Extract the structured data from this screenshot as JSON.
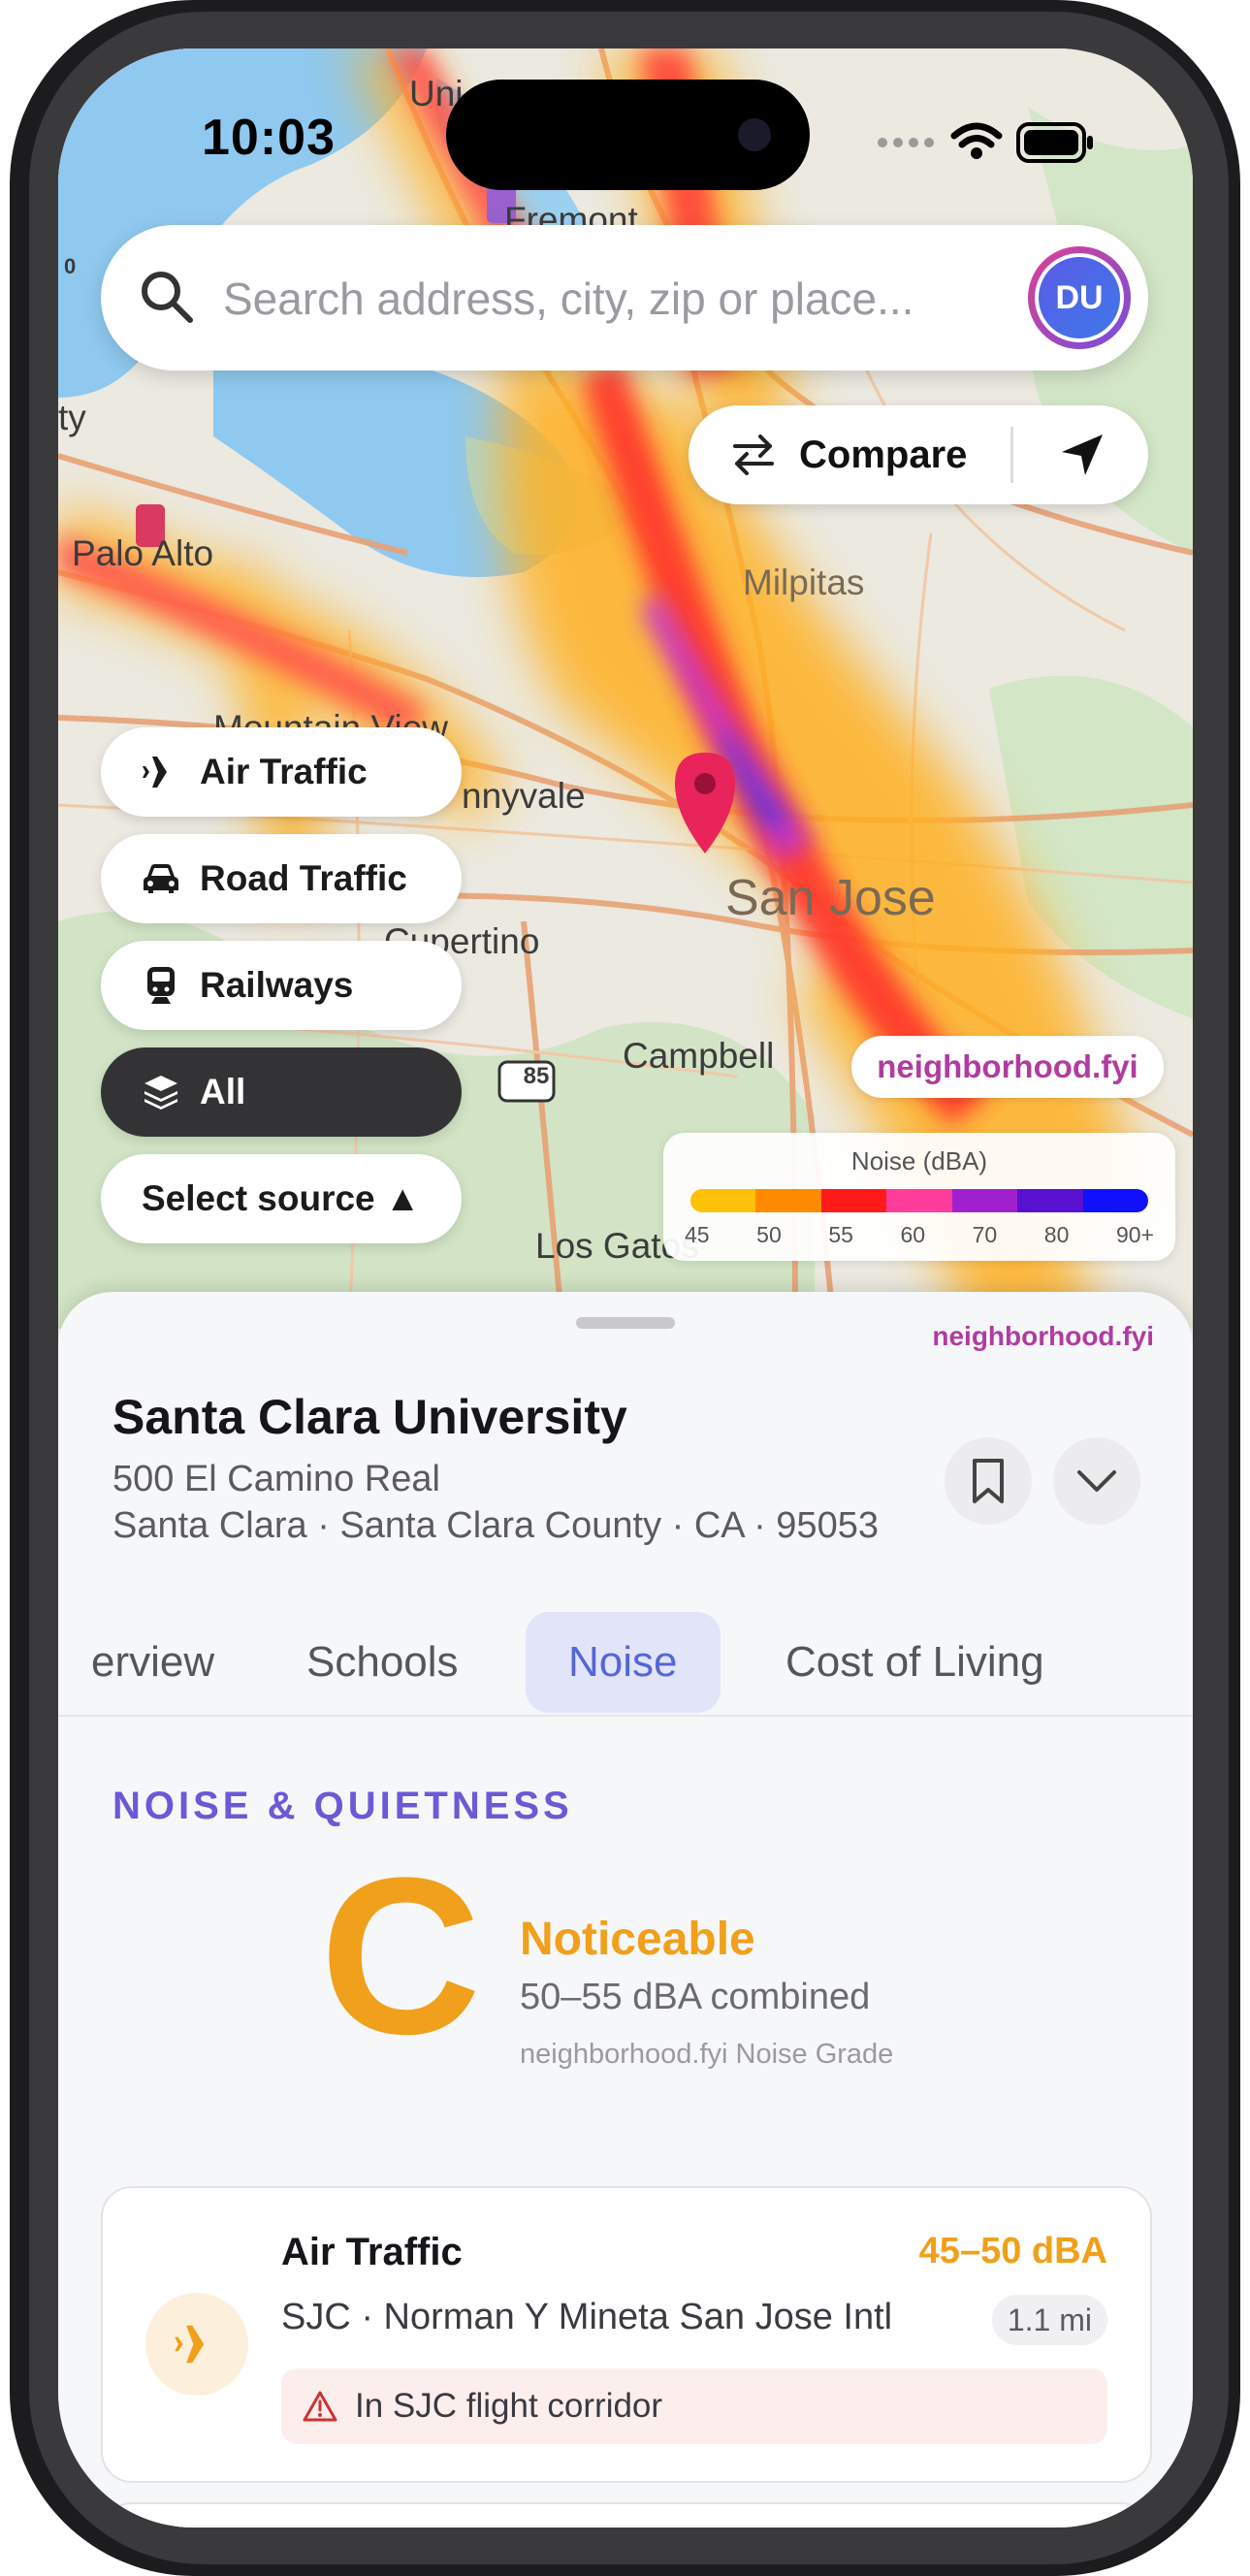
{
  "status_bar": {
    "time": "10:03"
  },
  "search": {
    "placeholder": "Search address, city, zip or place...",
    "avatar_initials": "DU"
  },
  "map_controls": {
    "compare_label": "Compare"
  },
  "map_labels": {
    "uni": "Uni",
    "fremont": "Fremont",
    "palo_alto": "Palo Alto",
    "milpitas": "Milpitas",
    "mountain_view": "Mountain View",
    "sunnyvale": "nnyvale",
    "san_jose": "San Jose",
    "cupertino": "Cupertino",
    "campbell": "Campbell",
    "los_gatos": "Los Gatos",
    "highway_85": "85",
    "edge_ty": "ty",
    "edge_zero": "0"
  },
  "layers": {
    "items": [
      {
        "label": "Air Traffic",
        "icon": "airplane-icon",
        "active": false
      },
      {
        "label": "Road Traffic",
        "icon": "car-icon",
        "active": false
      },
      {
        "label": "Railways",
        "icon": "train-icon",
        "active": false
      },
      {
        "label": "All",
        "icon": "layers-icon",
        "active": true
      }
    ],
    "select_source_label": "Select source ▲"
  },
  "brand": "neighborhood.fyi",
  "legend": {
    "title": "Noise (dBA)",
    "ticks": [
      "45",
      "50",
      "55",
      "60",
      "70",
      "80",
      "90+"
    ],
    "colors": [
      "#ffc107",
      "#ff8a00",
      "#ff1a1a",
      "#ff3d9a",
      "#a020d0",
      "#5a10d0",
      "#1010ff"
    ]
  },
  "place": {
    "name": "Santa Clara University",
    "address": "500 El Camino Real",
    "location": "Santa Clara · Santa Clara County · CA · 95053"
  },
  "tabs": [
    "erview",
    "Schools",
    "Noise",
    "Cost of Living"
  ],
  "active_tab": "Noise",
  "noise": {
    "section_title": "NOISE & QUIETNESS",
    "grade": "C",
    "grade_label": "Noticeable",
    "range": "50–55 dBA combined",
    "caption": "neighborhood.fyi Noise Grade"
  },
  "sources": [
    {
      "title": "Air Traffic",
      "value": "45–50 dBA",
      "airport": "SJC · Norman Y Mineta San Jose Intl",
      "distance": "1.1 mi",
      "alert": "In SJC flight corridor"
    }
  ],
  "colors": {
    "accent": "#6a5ad6",
    "grade": "#f0a01a",
    "brand": "#b03ca0",
    "tab_active_bg": "#e2e5f9"
  }
}
